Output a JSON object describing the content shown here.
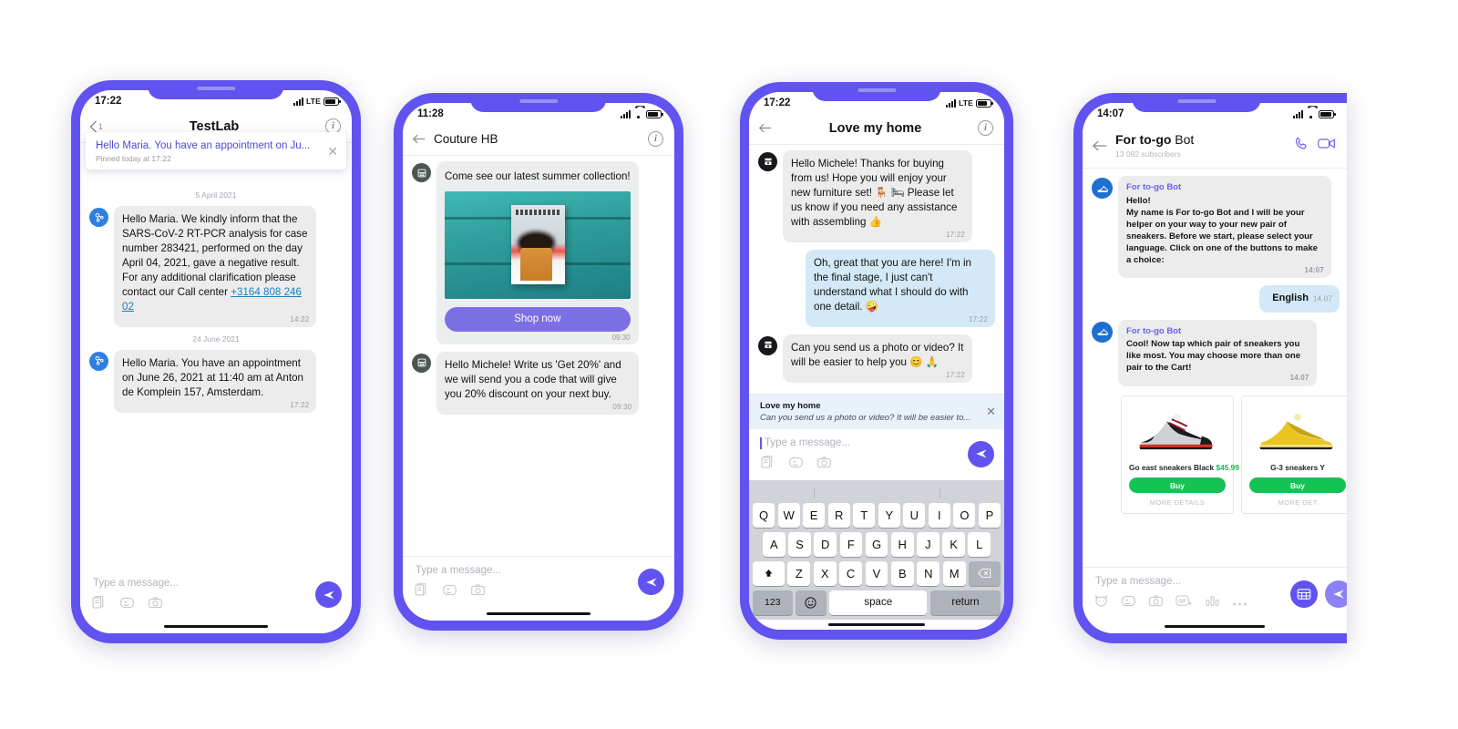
{
  "phones": [
    {
      "id": "phone-testlab",
      "status": {
        "time": "17:22",
        "network": "LTE",
        "signal_icon": "signal-bars-icon",
        "battery_icon": "battery-icon"
      },
      "header": {
        "back_label": "1",
        "title": "TestLab",
        "info_icon": "info-icon",
        "back_icon": "chevron-left-icon"
      },
      "pinned": {
        "text": "Hello Maria. You have an appointment on Ju...",
        "sub": "Pinned today at 17:22",
        "close_icon": "close-icon"
      },
      "messages": [
        {
          "kind": "daysep",
          "text": "5 April 2021"
        },
        {
          "kind": "in",
          "avatar_icon": "molecule-avatar-icon",
          "text_before": "Hello Maria. We kindly inform that the SARS-CoV-2 RT-PCR analysis for case number 283421, performed on the day April 04, 2021, gave a negative result. For any additional clarification please contact our Call center ",
          "link": "+3164 808 246 02",
          "time": "14:22"
        },
        {
          "kind": "daysep",
          "text": "24 June 2021"
        },
        {
          "kind": "in",
          "avatar_icon": "molecule-avatar-icon",
          "text_before": "Hello Maria. You have an appointment on June 26, 2021 at 11:40 am at Anton de Komplein 157, Amsterdam.",
          "link": "",
          "time": "17:22"
        }
      ],
      "composer": {
        "placeholder": "Type a message...",
        "icons": [
          "documents-icon",
          "sticker-icon",
          "camera-icon"
        ],
        "send_icon": "send-icon"
      }
    },
    {
      "id": "phone-couture",
      "status": {
        "time": "11:28",
        "network": "",
        "signal_icon": "signal-bars-icon",
        "wifi_icon": "wifi-icon",
        "battery_icon": "battery-icon"
      },
      "header": {
        "title": "Couture HB",
        "info_icon": "info-icon",
        "back_icon": "arrow-left-icon"
      },
      "messages": [
        {
          "kind": "card",
          "avatar_icon": "store-avatar-icon",
          "text": "Come see our latest summer collection!",
          "image_alt": "summer-collection-photo",
          "button": "Shop now",
          "time": "09:30"
        },
        {
          "kind": "in",
          "avatar_icon": "store-avatar-icon",
          "text_before": "Hello Michele! Write us 'Get 20%' and we will send you a code that will give you 20% discount on your next buy.",
          "link": "",
          "time": "09:30"
        }
      ],
      "composer": {
        "placeholder": "Type a message...",
        "icons": [
          "documents-icon",
          "sticker-icon",
          "camera-icon"
        ],
        "send_icon": "send-icon"
      }
    },
    {
      "id": "phone-lovemyhome",
      "status": {
        "time": "17:22",
        "network": "LTE",
        "signal_icon": "signal-bars-icon",
        "battery_icon": "battery-icon"
      },
      "header": {
        "title": "Love my home",
        "info_icon": "info-icon",
        "back_icon": "arrow-left-icon"
      },
      "messages": [
        {
          "kind": "in",
          "avatar_icon": "furniture-avatar-icon",
          "text_before": "Hello Michele! Thanks for buying from us! Hope you will enjoy your new furniture set! 🪑 🛏 Please let us know if you need any assistance with assembling 👍",
          "link": "",
          "time": "17:22"
        },
        {
          "kind": "out",
          "text_before": "Oh, great that you are here! I'm in the final stage, I just can't understand what I should do with one detail. 🤪",
          "time": "17:22"
        },
        {
          "kind": "in",
          "avatar_icon": "furniture-avatar-icon",
          "text_before": "Can you send us a photo or video? It will be easier to help you 😊 🙏",
          "link": "",
          "time": "17:22"
        }
      ],
      "reply_preview": {
        "name": "Love my home",
        "text": "Can you send us a photo or video? It will be easier to...",
        "close_icon": "close-icon"
      },
      "composer": {
        "placeholder": "Type a message...",
        "icons": [
          "documents-icon",
          "sticker-icon",
          "camera-icon"
        ],
        "send_icon": "send-icon"
      },
      "keyboard": {
        "row1": [
          "Q",
          "W",
          "E",
          "R",
          "T",
          "Y",
          "U",
          "I",
          "O",
          "P"
        ],
        "row2": [
          "A",
          "S",
          "D",
          "F",
          "G",
          "H",
          "J",
          "K",
          "L"
        ],
        "row3": [
          "Z",
          "X",
          "C",
          "V",
          "B",
          "N",
          "M"
        ],
        "shift_icon": "shift-icon",
        "backspace_icon": "backspace-icon",
        "numbers_key": "123",
        "emoji_icon": "emoji-icon",
        "space_key": "space",
        "return_key": "return"
      }
    },
    {
      "id": "phone-togobot",
      "status": {
        "time": "14:07",
        "network": "",
        "signal_icon": "signal-bars-icon",
        "wifi_icon": "wifi-icon",
        "battery_icon": "battery-icon"
      },
      "header": {
        "title_bold": "For to-go",
        "title_rest": " Bot",
        "subtitle": "13 092 subscribers",
        "back_icon": "arrow-left-icon",
        "call_icon": "phone-call-icon",
        "video_icon": "video-camera-icon"
      },
      "messages": [
        {
          "kind": "bot",
          "avatar_icon": "sneaker-avatar-icon",
          "bot_name": "For to-go Bot",
          "text": "Hello!\nMy name is For to-go Bot and I will be your helper on your way to your new pair of sneakers. Before we start, please select your language. Click on one of the buttons to make a choice:",
          "time": "14:07"
        },
        {
          "kind": "out-pill",
          "text": "English",
          "time": "14.07"
        },
        {
          "kind": "bot",
          "avatar_icon": "sneaker-avatar-icon",
          "bot_name": "For to-go Bot",
          "text": "Cool! Now tap which pair of sneakers you like most. You may choose more than one pair to the Cart!",
          "time": "14.07"
        }
      ],
      "products": [
        {
          "title": "Go east sneakers Black",
          "price": "$45.99",
          "buy": "Buy",
          "more": "MORE DETAILS",
          "color": "black"
        },
        {
          "title": "G-3 sneakers Y",
          "price": "",
          "buy": "Buy",
          "more": "MORE DET",
          "color": "yellow"
        }
      ],
      "composer": {
        "placeholder": "Type a message...",
        "icons": [
          "cat-sticker-icon",
          "sticker-icon",
          "camera-icon",
          "gif-icon",
          "poll-icon",
          "more-icon"
        ],
        "keyboard_icon": "bot-keyboard-icon",
        "send_icon": "send-icon"
      }
    }
  ],
  "colors": {
    "brand_purple": "#6153f0",
    "bubble_in": "#ececed",
    "bubble_out": "#d3e9f7",
    "link_blue": "#1a7fbf",
    "buy_green": "#15c254",
    "bot_name": "#6a5ff0"
  }
}
